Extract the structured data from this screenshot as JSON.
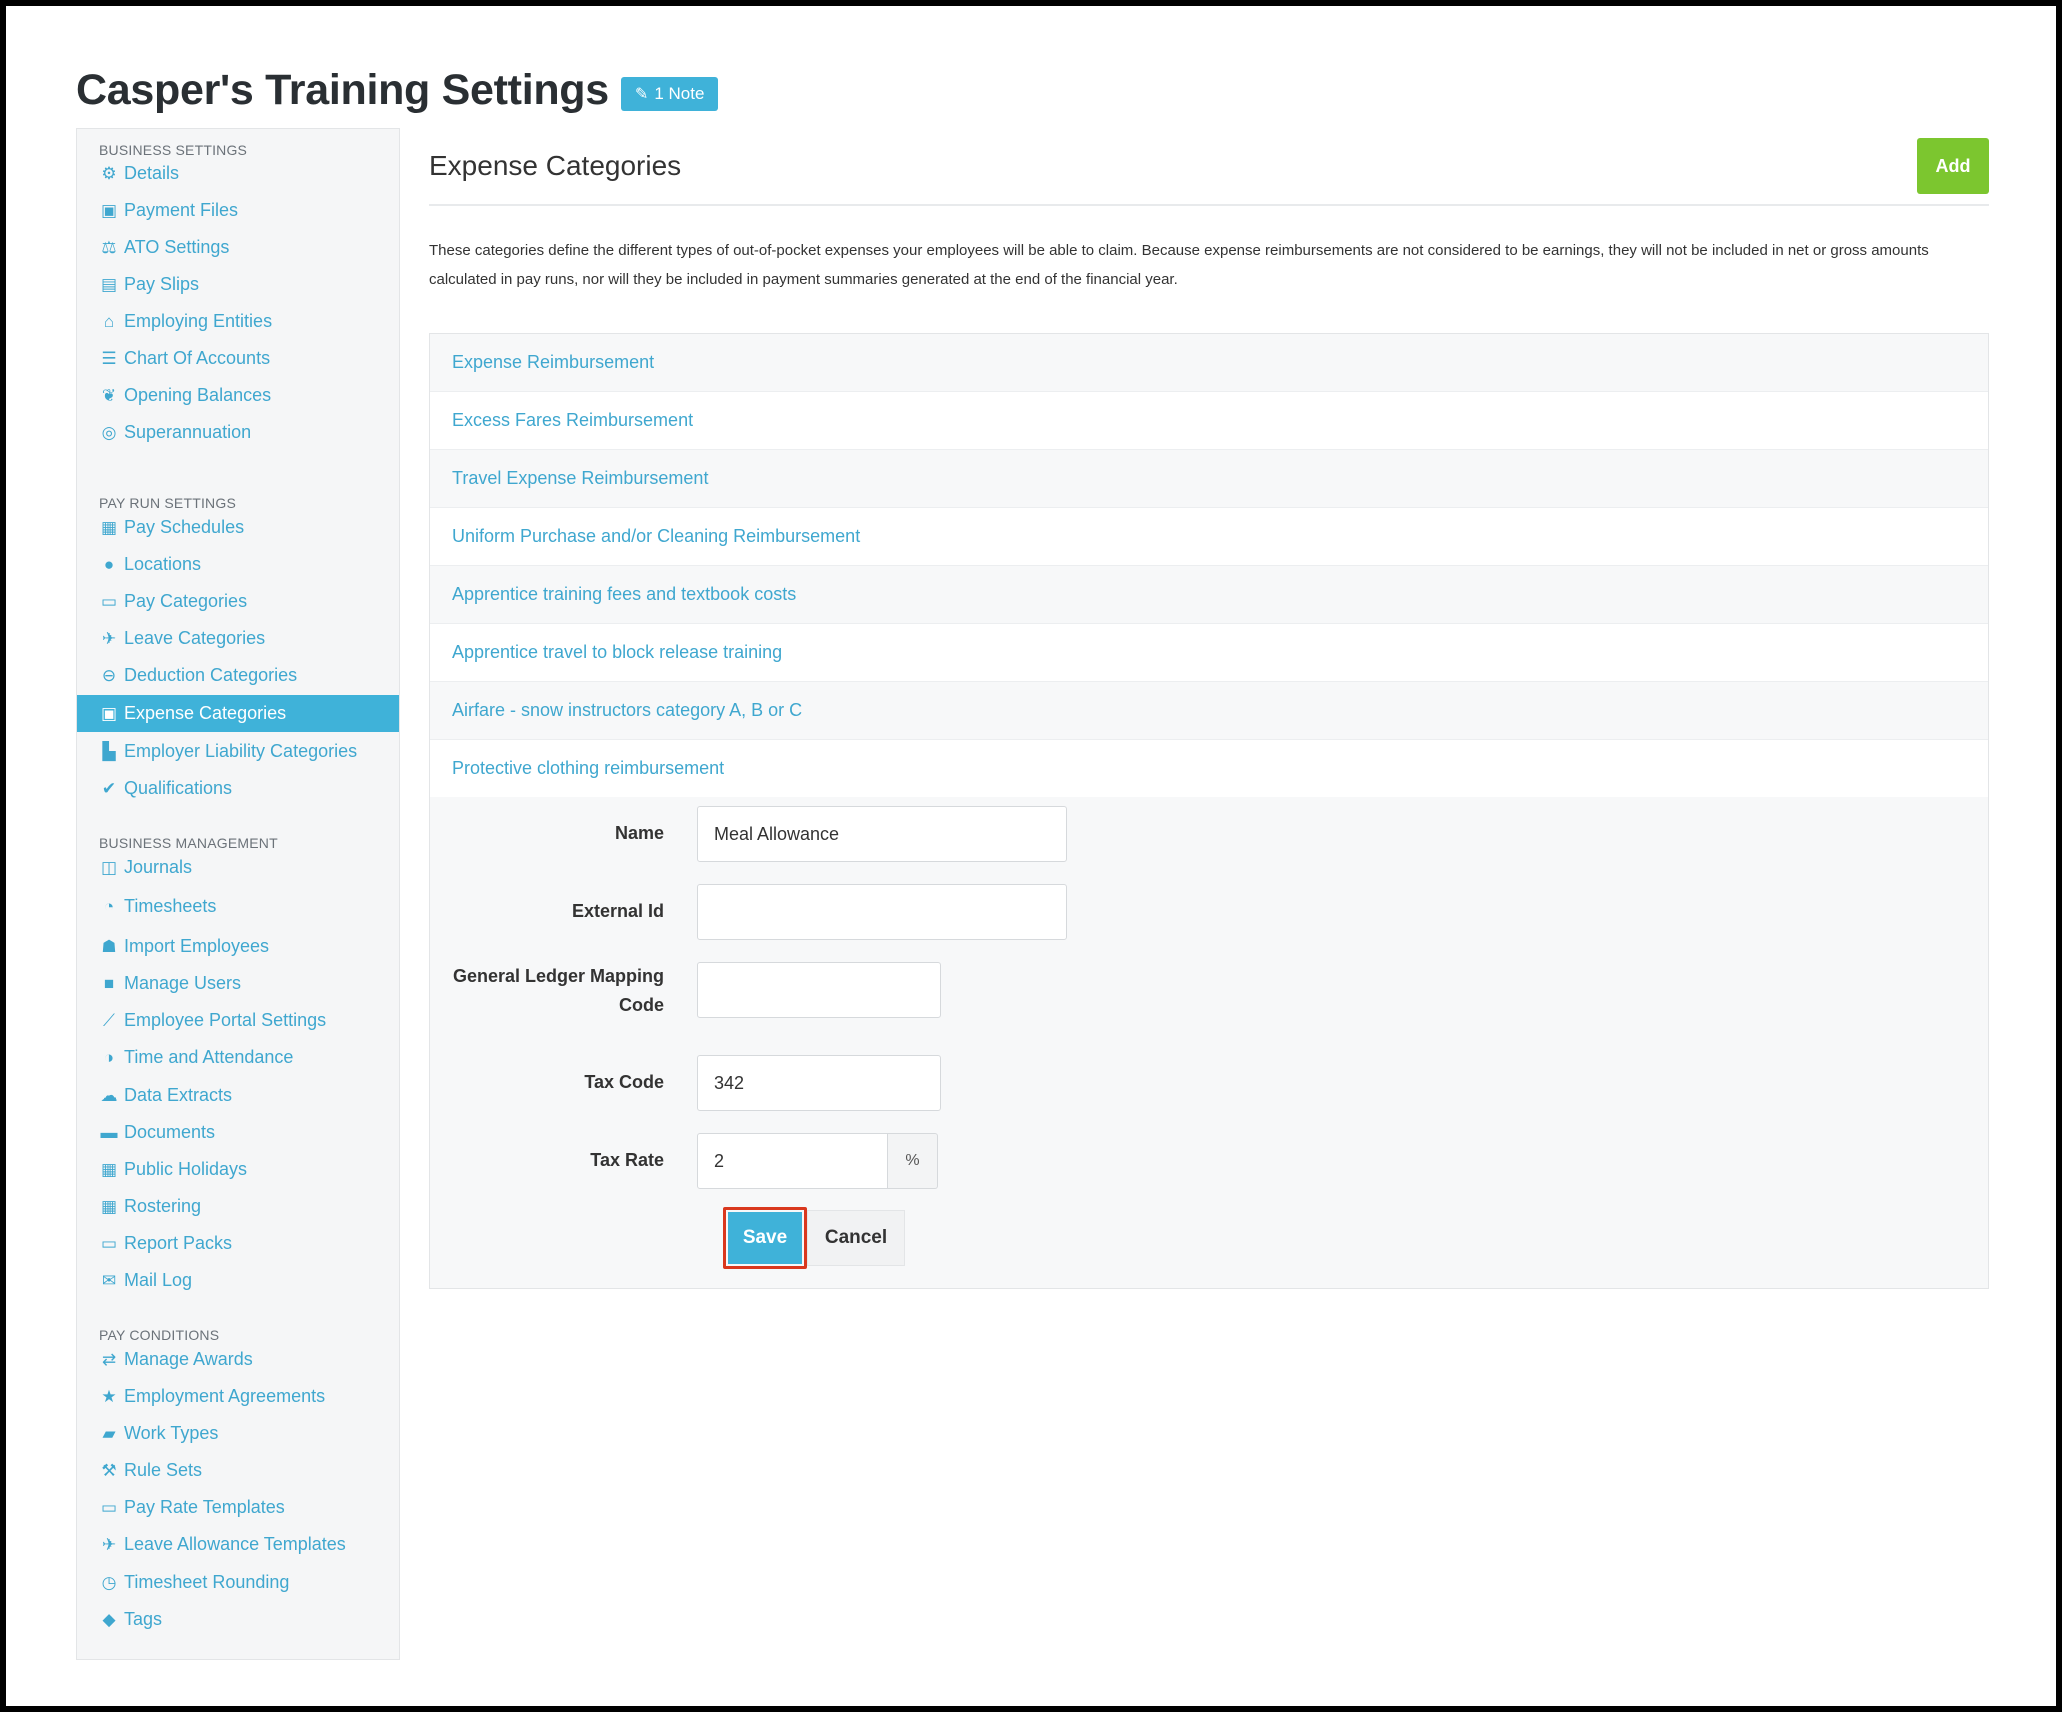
{
  "page": {
    "title": "Casper's Training Settings",
    "note_badge": "1 Note"
  },
  "sidebar": {
    "sections": [
      "BUSINESS SETTINGS",
      "PAY RUN SETTINGS",
      "BUSINESS MANAGEMENT",
      "PAY CONDITIONS"
    ],
    "business_settings": [
      "Details",
      "Payment Files",
      "ATO Settings",
      "Pay Slips",
      "Employing Entities",
      "Chart Of Accounts",
      "Opening Balances",
      "Superannuation"
    ],
    "pay_run_settings": [
      "Pay Schedules",
      "Locations",
      "Pay Categories",
      "Leave Categories",
      "Deduction Categories",
      "Expense Categories",
      "Employer Liability Categories",
      "Qualifications"
    ],
    "business_management": [
      "Journals",
      "Timesheets",
      "Import Employees",
      "Manage Users",
      "Employee Portal Settings",
      "Time and Attendance",
      "Data Extracts",
      "Documents",
      "Public Holidays",
      "Rostering",
      "Report Packs",
      "Mail Log"
    ],
    "pay_conditions": [
      "Manage Awards",
      "Employment Agreements",
      "Work Types",
      "Rule Sets",
      "Pay Rate Templates",
      "Leave Allowance Templates",
      "Timesheet Rounding",
      "Tags"
    ],
    "active_item": "Expense Categories"
  },
  "main": {
    "heading": "Expense Categories",
    "add_label": "Add",
    "description": "These categories define the different types of out-of-pocket expenses your employees will be able to claim. Because expense reimbursements are not considered to be earnings, they will not be included in net or gross amounts calculated in pay runs, nor will they be included in payment summaries generated at the end of the financial year.",
    "categories": [
      "Expense Reimbursement",
      "Excess Fares Reimbursement",
      "Travel Expense Reimbursement",
      "Uniform Purchase and/or Cleaning Reimbursement",
      "Apprentice training fees and textbook costs",
      "Apprentice travel to block release training",
      "Airfare - snow instructors category A, B or C",
      "Protective clothing reimbursement"
    ]
  },
  "form": {
    "name_label": "Name",
    "name_value": "Meal Allowance",
    "external_id_label": "External Id",
    "external_id_value": "",
    "gl_label": "General Ledger Mapping Code",
    "gl_value": "",
    "tax_code_label": "Tax Code",
    "tax_code_value": "342",
    "tax_rate_label": "Tax Rate",
    "tax_rate_value": "2",
    "tax_rate_suffix": "%",
    "save_label": "Save",
    "cancel_label": "Cancel"
  },
  "colors": {
    "accent": "#3fb2d9",
    "link": "#3fa7cf",
    "add_button": "#7cc62f",
    "highlight": "#d9381e"
  }
}
